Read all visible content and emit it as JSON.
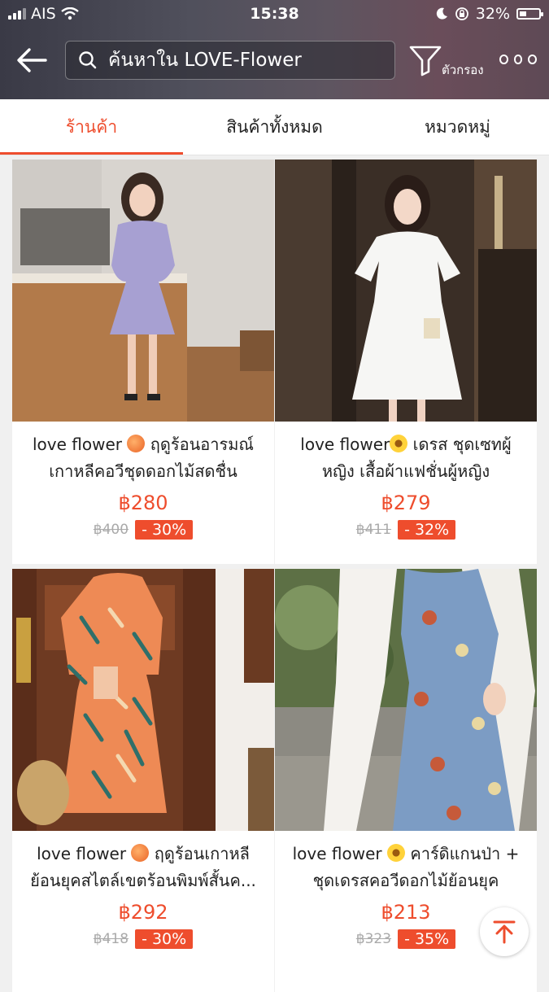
{
  "status_bar": {
    "carrier": "AIS",
    "time": "15:38",
    "battery": "32%"
  },
  "header": {
    "search_placeholder": "ค้นหาใน LOVE-Flower",
    "filter_label": "ตัวกรอง"
  },
  "tabs": [
    {
      "label": "ร้านค้า",
      "active": true
    },
    {
      "label": "สินค้าทั้งหมด",
      "active": false
    },
    {
      "label": "หมวดหมู่",
      "active": false
    }
  ],
  "products": [
    {
      "title_line1": "love flower",
      "emoji": "peach",
      "title_line1_rest": "ฤดูร้อนอารมณ์",
      "title_line2": "เกาหลีคอวีชุดดอกไม้สดชื่น",
      "price": "฿280",
      "original_price": "฿400",
      "discount": "- 30%",
      "image": "purple-floral-dress"
    },
    {
      "title_line1": "love flower",
      "emoji": "sunflower",
      "title_line1_rest": "เดรส ชุดเซทผู้",
      "title_line2": "หญิง เสื้อผ้าแฟชั่นผู้หญิง",
      "price": "฿279",
      "original_price": "฿411",
      "discount": "- 32%",
      "image": "white-lace-dress"
    },
    {
      "title_line1": "love flower",
      "emoji": "peach",
      "title_line1_rest": "ฤดูร้อนเกาหลี",
      "title_line2": "ย้อนยุคสไตล์เขตร้อนพิมพ์สั้นค...",
      "price": "฿292",
      "original_price": "฿418",
      "discount": "- 30%",
      "image": "orange-tropical-dress"
    },
    {
      "title_line1": "love flower",
      "emoji": "sunflower",
      "title_line1_rest": "คาร์ดิแกนป่า +",
      "title_line2": "ชุดเดรสคอวีดอกไม้ย้อนยุค",
      "price": "฿213",
      "original_price": "฿323",
      "discount": "- 35%",
      "image": "blue-floral-dress"
    }
  ],
  "colors": {
    "accent": "#ee4d2d",
    "header_bg": "#4b4753"
  }
}
